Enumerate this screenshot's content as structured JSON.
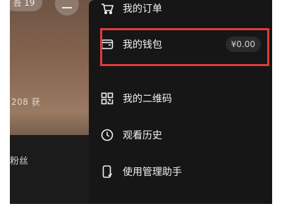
{
  "background": {
    "top_pill_text": "吾 19",
    "profile_stat": "208 获",
    "fans_label": "粉丝"
  },
  "menu": {
    "items": [
      {
        "label": "我的订单",
        "icon": "cart-icon"
      },
      {
        "label": "我的钱包",
        "icon": "wallet-icon",
        "badge": "¥0.00"
      },
      {
        "label": "我的二维码",
        "icon": "qr-code-icon"
      },
      {
        "label": "观看历史",
        "icon": "clock-icon"
      },
      {
        "label": "使用管理助手",
        "icon": "phone-manage-icon"
      }
    ]
  },
  "colors": {
    "highlight": "#e03a3a",
    "panel": "#161617",
    "text": "#f2f2f2"
  }
}
